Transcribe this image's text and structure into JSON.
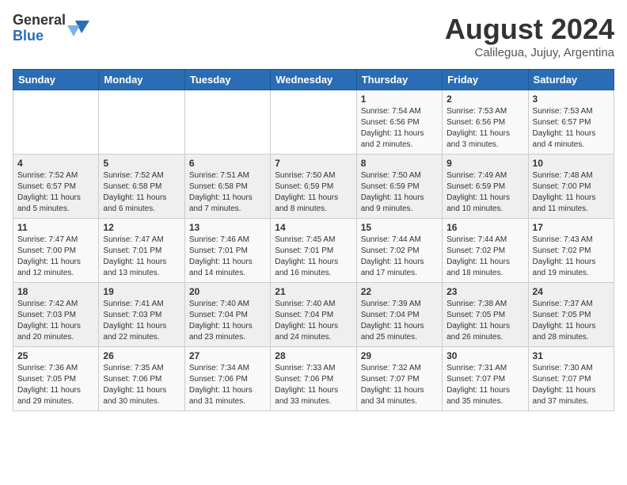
{
  "logo": {
    "general": "General",
    "blue": "Blue"
  },
  "title": "August 2024",
  "subtitle": "Calilegua, Jujuy, Argentina",
  "days_header": [
    "Sunday",
    "Monday",
    "Tuesday",
    "Wednesday",
    "Thursday",
    "Friday",
    "Saturday"
  ],
  "weeks": [
    [
      {
        "day": "",
        "info": ""
      },
      {
        "day": "",
        "info": ""
      },
      {
        "day": "",
        "info": ""
      },
      {
        "day": "",
        "info": ""
      },
      {
        "day": "1",
        "info": "Sunrise: 7:54 AM\nSunset: 6:56 PM\nDaylight: 11 hours\nand 2 minutes."
      },
      {
        "day": "2",
        "info": "Sunrise: 7:53 AM\nSunset: 6:56 PM\nDaylight: 11 hours\nand 3 minutes."
      },
      {
        "day": "3",
        "info": "Sunrise: 7:53 AM\nSunset: 6:57 PM\nDaylight: 11 hours\nand 4 minutes."
      }
    ],
    [
      {
        "day": "4",
        "info": "Sunrise: 7:52 AM\nSunset: 6:57 PM\nDaylight: 11 hours\nand 5 minutes."
      },
      {
        "day": "5",
        "info": "Sunrise: 7:52 AM\nSunset: 6:58 PM\nDaylight: 11 hours\nand 6 minutes."
      },
      {
        "day": "6",
        "info": "Sunrise: 7:51 AM\nSunset: 6:58 PM\nDaylight: 11 hours\nand 7 minutes."
      },
      {
        "day": "7",
        "info": "Sunrise: 7:50 AM\nSunset: 6:59 PM\nDaylight: 11 hours\nand 8 minutes."
      },
      {
        "day": "8",
        "info": "Sunrise: 7:50 AM\nSunset: 6:59 PM\nDaylight: 11 hours\nand 9 minutes."
      },
      {
        "day": "9",
        "info": "Sunrise: 7:49 AM\nSunset: 6:59 PM\nDaylight: 11 hours\nand 10 minutes."
      },
      {
        "day": "10",
        "info": "Sunrise: 7:48 AM\nSunset: 7:00 PM\nDaylight: 11 hours\nand 11 minutes."
      }
    ],
    [
      {
        "day": "11",
        "info": "Sunrise: 7:47 AM\nSunset: 7:00 PM\nDaylight: 11 hours\nand 12 minutes."
      },
      {
        "day": "12",
        "info": "Sunrise: 7:47 AM\nSunset: 7:01 PM\nDaylight: 11 hours\nand 13 minutes."
      },
      {
        "day": "13",
        "info": "Sunrise: 7:46 AM\nSunset: 7:01 PM\nDaylight: 11 hours\nand 14 minutes."
      },
      {
        "day": "14",
        "info": "Sunrise: 7:45 AM\nSunset: 7:01 PM\nDaylight: 11 hours\nand 16 minutes."
      },
      {
        "day": "15",
        "info": "Sunrise: 7:44 AM\nSunset: 7:02 PM\nDaylight: 11 hours\nand 17 minutes."
      },
      {
        "day": "16",
        "info": "Sunrise: 7:44 AM\nSunset: 7:02 PM\nDaylight: 11 hours\nand 18 minutes."
      },
      {
        "day": "17",
        "info": "Sunrise: 7:43 AM\nSunset: 7:02 PM\nDaylight: 11 hours\nand 19 minutes."
      }
    ],
    [
      {
        "day": "18",
        "info": "Sunrise: 7:42 AM\nSunset: 7:03 PM\nDaylight: 11 hours\nand 20 minutes."
      },
      {
        "day": "19",
        "info": "Sunrise: 7:41 AM\nSunset: 7:03 PM\nDaylight: 11 hours\nand 22 minutes."
      },
      {
        "day": "20",
        "info": "Sunrise: 7:40 AM\nSunset: 7:04 PM\nDaylight: 11 hours\nand 23 minutes."
      },
      {
        "day": "21",
        "info": "Sunrise: 7:40 AM\nSunset: 7:04 PM\nDaylight: 11 hours\nand 24 minutes."
      },
      {
        "day": "22",
        "info": "Sunrise: 7:39 AM\nSunset: 7:04 PM\nDaylight: 11 hours\nand 25 minutes."
      },
      {
        "day": "23",
        "info": "Sunrise: 7:38 AM\nSunset: 7:05 PM\nDaylight: 11 hours\nand 26 minutes."
      },
      {
        "day": "24",
        "info": "Sunrise: 7:37 AM\nSunset: 7:05 PM\nDaylight: 11 hours\nand 28 minutes."
      }
    ],
    [
      {
        "day": "25",
        "info": "Sunrise: 7:36 AM\nSunset: 7:05 PM\nDaylight: 11 hours\nand 29 minutes."
      },
      {
        "day": "26",
        "info": "Sunrise: 7:35 AM\nSunset: 7:06 PM\nDaylight: 11 hours\nand 30 minutes."
      },
      {
        "day": "27",
        "info": "Sunrise: 7:34 AM\nSunset: 7:06 PM\nDaylight: 11 hours\nand 31 minutes."
      },
      {
        "day": "28",
        "info": "Sunrise: 7:33 AM\nSunset: 7:06 PM\nDaylight: 11 hours\nand 33 minutes."
      },
      {
        "day": "29",
        "info": "Sunrise: 7:32 AM\nSunset: 7:07 PM\nDaylight: 11 hours\nand 34 minutes."
      },
      {
        "day": "30",
        "info": "Sunrise: 7:31 AM\nSunset: 7:07 PM\nDaylight: 11 hours\nand 35 minutes."
      },
      {
        "day": "31",
        "info": "Sunrise: 7:30 AM\nSunset: 7:07 PM\nDaylight: 11 hours\nand 37 minutes."
      }
    ]
  ]
}
